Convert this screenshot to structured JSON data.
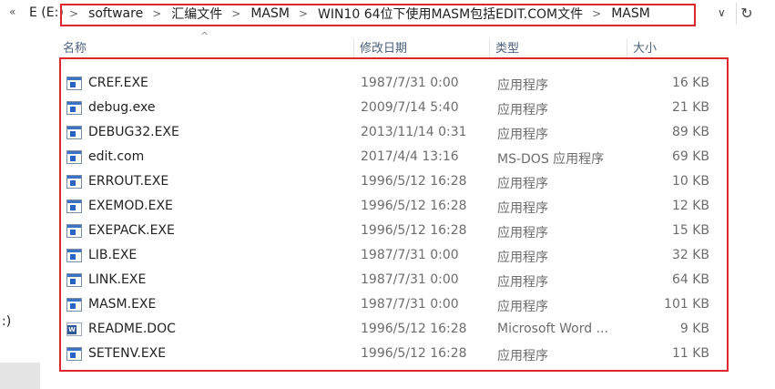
{
  "address_bar": {
    "back_glyph": "«",
    "drive": "E (E:)",
    "crumbs": [
      "software",
      "汇编文件",
      "MASM",
      "WIN10 64位下使用MASM包括EDIT.COM文件",
      "MASM"
    ],
    "dropdown_glyph": "∨",
    "refresh_glyph": "↻"
  },
  "sidebar": {
    "partial_text": ":)"
  },
  "columns": {
    "name": "名称",
    "date": "修改日期",
    "type": "类型",
    "size": "大小",
    "sort_glyph": "^"
  },
  "files": [
    {
      "name": "CREF.EXE",
      "date": "1987/7/31 0:00",
      "type": "应用程序",
      "size": "16 KB",
      "icon": "exe-icon"
    },
    {
      "name": "debug.exe",
      "date": "2009/7/14 5:40",
      "type": "应用程序",
      "size": "21 KB",
      "icon": "exe-icon"
    },
    {
      "name": "DEBUG32.EXE",
      "date": "2013/11/14 0:31",
      "type": "应用程序",
      "size": "89 KB",
      "icon": "exe-icon"
    },
    {
      "name": "edit.com",
      "date": "2017/4/4 13:16",
      "type": "MS-DOS 应用程序",
      "size": "69 KB",
      "icon": "exe-icon"
    },
    {
      "name": "ERROUT.EXE",
      "date": "1996/5/12 16:28",
      "type": "应用程序",
      "size": "10 KB",
      "icon": "exe-icon"
    },
    {
      "name": "EXEMOD.EXE",
      "date": "1996/5/12 16:28",
      "type": "应用程序",
      "size": "12 KB",
      "icon": "exe-icon"
    },
    {
      "name": "EXEPACK.EXE",
      "date": "1996/5/12 16:28",
      "type": "应用程序",
      "size": "15 KB",
      "icon": "exe-icon"
    },
    {
      "name": "LIB.EXE",
      "date": "1987/7/31 0:00",
      "type": "应用程序",
      "size": "32 KB",
      "icon": "exe-icon"
    },
    {
      "name": "LINK.EXE",
      "date": "1987/7/31 0:00",
      "type": "应用程序",
      "size": "64 KB",
      "icon": "exe-icon"
    },
    {
      "name": "MASM.EXE",
      "date": "1987/7/31 0:00",
      "type": "应用程序",
      "size": "101 KB",
      "icon": "exe-icon"
    },
    {
      "name": "README.DOC",
      "date": "1996/5/12 16:28",
      "type": "Microsoft Word ...",
      "size": "9 KB",
      "icon": "word-doc-icon"
    },
    {
      "name": "SETENV.EXE",
      "date": "1996/5/12 16:28",
      "type": "应用程序",
      "size": "11 KB",
      "icon": "exe-icon"
    }
  ],
  "colors": {
    "highlight_border": "#e0262f",
    "header_text": "#4c607a"
  }
}
